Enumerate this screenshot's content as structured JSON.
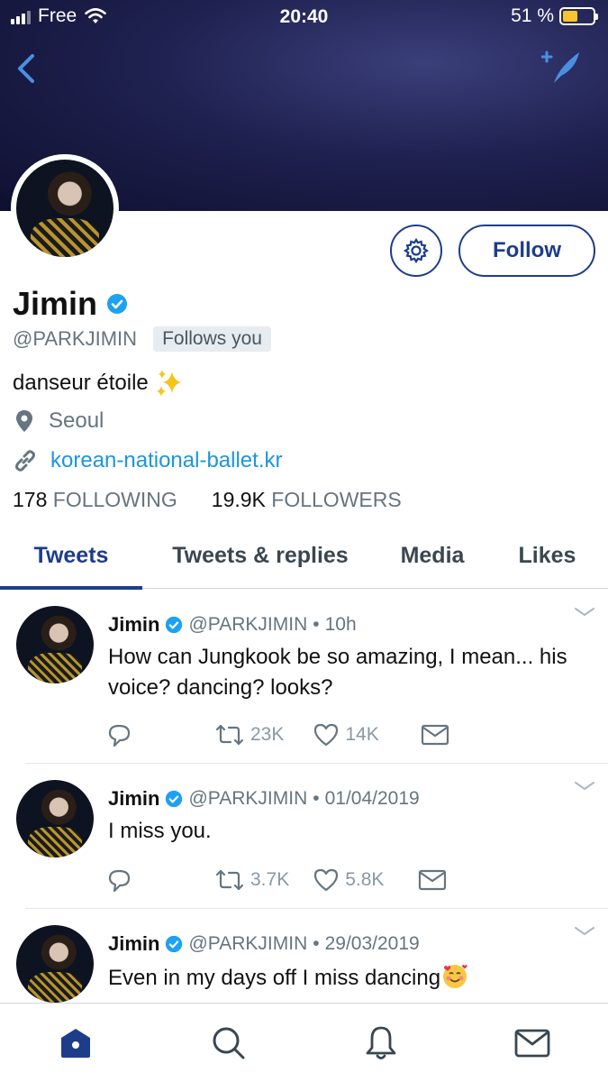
{
  "status_bar": {
    "carrier": "Free",
    "time": "20:40",
    "battery_percent": "51 %",
    "battery_level": 0.51
  },
  "colors": {
    "accent": "#1d3d8a",
    "link": "#1b95e0",
    "verified": "#1da1f2",
    "muted": "#66757f"
  },
  "profile": {
    "display_name": "Jimin",
    "handle": "@PARKJIMIN",
    "follows_you": "Follows you",
    "bio": "danseur étoile",
    "location": "Seoul",
    "website": "korean-national-ballet.kr",
    "following_count": "178",
    "following_label": "FOLLOWING",
    "followers_count": "19.9K",
    "followers_label": "FOLLOWERS",
    "follow_button": "Follow"
  },
  "tabs": [
    {
      "label": "Tweets",
      "active": true
    },
    {
      "label": "Tweets & replies",
      "active": false
    },
    {
      "label": "Media",
      "active": false
    },
    {
      "label": "Likes",
      "active": false
    }
  ],
  "tweets": [
    {
      "name": "Jimin",
      "handle": "@PARKJIMIN",
      "time": "10h",
      "text": "How can Jungkook be so amazing, I mean... his voice? dancing? looks?",
      "retweets": "23K",
      "likes": "14K"
    },
    {
      "name": "Jimin",
      "handle": "@PARKJIMIN",
      "time": "01/04/2019",
      "text": "I miss you.",
      "retweets": "3.7K",
      "likes": "5.8K"
    },
    {
      "name": "Jimin",
      "handle": "@PARKJIMIN",
      "time": "29/03/2019",
      "text": "Even in my days off I miss dancing"
    }
  ],
  "icons": {
    "back": "chevron-left-icon",
    "compose": "feather-sparkle-icon",
    "settings": "gear-icon",
    "verified": "verified-badge-icon",
    "location": "location-pin-icon",
    "link": "link-icon",
    "reply": "reply-bubble-icon",
    "retweet": "retweet-icon",
    "like": "heart-icon",
    "dm": "envelope-icon",
    "nav": [
      "home-icon",
      "search-icon",
      "bell-icon",
      "envelope-icon"
    ]
  }
}
